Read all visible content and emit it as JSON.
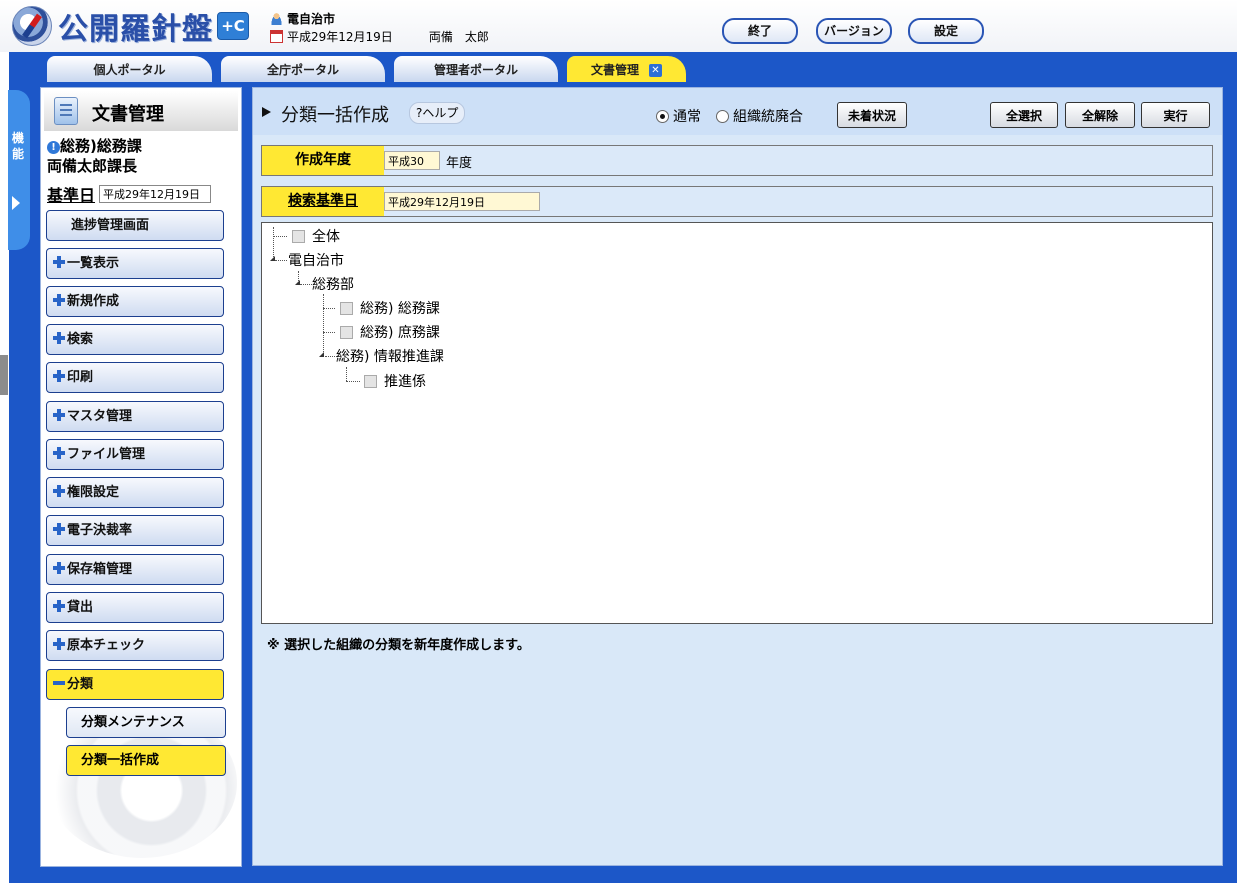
{
  "header": {
    "logo_text": "公開羅針盤",
    "logo_badge": "+C",
    "org": "電自治市",
    "date": "平成29年12月19日",
    "user": "両備　太郎",
    "buttons": {
      "end": "終了",
      "version": "バージョン",
      "settings": "設定"
    }
  },
  "tabs": [
    {
      "label": "個人ポータル"
    },
    {
      "label": "全庁ポータル"
    },
    {
      "label": "管理者ポータル"
    },
    {
      "label": "文書管理",
      "active": true,
      "close": "✕"
    }
  ],
  "side_handle": {
    "label": "機能"
  },
  "left": {
    "title": "文書管理",
    "dept": "総務)総務課",
    "user": "両備太郎課長",
    "base_date_label": "基準日",
    "base_date_value": "平成29年12月19日",
    "menu": [
      "進捗管理画面",
      "一覧表示",
      "新規作成",
      "検索",
      "印刷",
      "マスタ管理",
      "ファイル管理",
      "権限設定",
      "電子決裁率",
      "保存箱管理",
      "貸出",
      "原本チェック",
      "分類"
    ],
    "submenu": [
      "分類メンテナンス",
      "分類一括作成"
    ]
  },
  "main": {
    "title": "分類一括作成",
    "help": "?ヘルプ",
    "radio_normal": "通常",
    "radio_merge": "組織統廃合",
    "buttons": {
      "unarrived": "未着状況",
      "select_all": "全選択",
      "deselect_all": "全解除",
      "execute": "実行"
    },
    "year_label": "作成年度",
    "year_value": "平成30",
    "year_suffix": "年度",
    "search_label": "検索基準日",
    "search_value": "平成29年12月19日",
    "tree": {
      "all": "全体",
      "city": "電自治市",
      "dept": "総務部",
      "div1": "総務) 総務課",
      "div2": "総務) 庶務課",
      "div3": "総務) 情報推進課",
      "sec": "推進係"
    },
    "note": "※ 選択した組織の分類を新年度作成します。"
  }
}
